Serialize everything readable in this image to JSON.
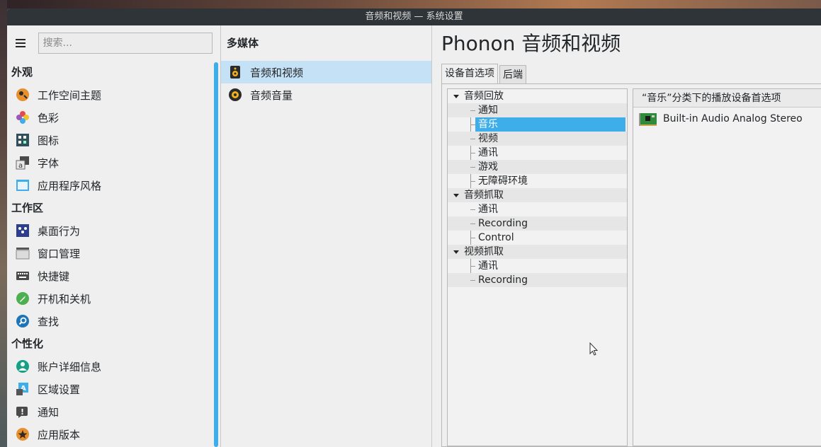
{
  "window": {
    "title": "音频和视频 — 系统设置"
  },
  "sidebar": {
    "search_placeholder": "搜索...",
    "categories": [
      {
        "header": "外观",
        "items": [
          {
            "label": "工作空间主题",
            "icon": "workspace-theme-icon"
          },
          {
            "label": "色彩",
            "icon": "color-icon"
          },
          {
            "label": "图标",
            "icon": "icons-icon"
          },
          {
            "label": "字体",
            "icon": "font-icon"
          },
          {
            "label": "应用程序风格",
            "icon": "app-style-icon"
          }
        ]
      },
      {
        "header": "工作区",
        "items": [
          {
            "label": "桌面行为",
            "icon": "desktop-behavior-icon"
          },
          {
            "label": "窗口管理",
            "icon": "window-management-icon"
          },
          {
            "label": "快捷键",
            "icon": "keyboard-icon"
          },
          {
            "label": "开机和关机",
            "icon": "startup-rocket-icon"
          },
          {
            "label": "查找",
            "icon": "search-icon"
          }
        ]
      },
      {
        "header": "个性化",
        "items": [
          {
            "label": "账户详细信息",
            "icon": "account-icon"
          },
          {
            "label": "区域设置",
            "icon": "locale-icon"
          },
          {
            "label": "通知",
            "icon": "notification-icon"
          },
          {
            "label": "应用版本",
            "icon": "app-version-star-icon"
          }
        ]
      }
    ]
  },
  "middle": {
    "title": "多媒体",
    "items": [
      {
        "label": "音频和视频",
        "icon": "speaker-icon",
        "selected": true
      },
      {
        "label": "音频音量",
        "icon": "volume-icon",
        "selected": false
      }
    ]
  },
  "main": {
    "title": "Phonon 音频和视频",
    "tabs": [
      {
        "label": "设备首选项",
        "active": true
      },
      {
        "label": "后端",
        "active": false
      }
    ],
    "tree": {
      "playback": {
        "label": "音频回放",
        "children": [
          "通知",
          "音乐",
          "视频",
          "通讯",
          "游戏",
          "无障碍环境"
        ]
      },
      "capture": {
        "label": "音频抓取",
        "children": [
          "通讯",
          "Recording",
          "Control"
        ]
      },
      "video": {
        "label": "视频抓取",
        "children": [
          "通讯",
          "Recording"
        ]
      },
      "selected": "音乐"
    },
    "device_list": {
      "header": "“音乐”分类下的播放设备首选项",
      "devices": [
        {
          "label": "Built-in Audio Analog Stereo",
          "icon": "audio-card-icon"
        }
      ]
    }
  },
  "colors": {
    "accent": "#3daee9",
    "selection": "#c4e1f5",
    "titlebar": "#2f3438"
  }
}
